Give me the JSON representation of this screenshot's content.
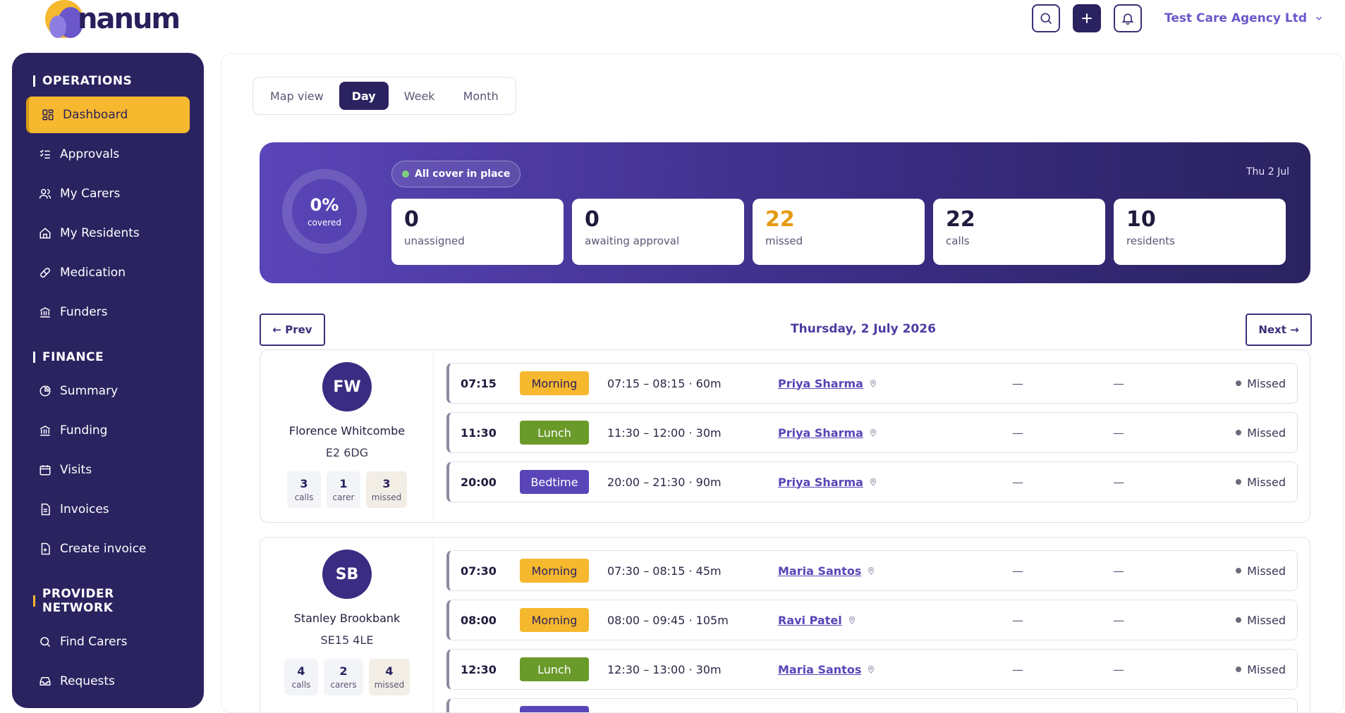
{
  "brand": {
    "name": "nanum"
  },
  "header": {
    "agency": "Test Care Agency Ltd"
  },
  "sidebar": {
    "sections": [
      {
        "title": "OPERATIONS",
        "items": [
          "Dashboard",
          "Approvals",
          "My Carers",
          "My Residents",
          "Medication",
          "Funders"
        ]
      },
      {
        "title": "FINANCE",
        "items": [
          "Summary",
          "Funding",
          "Visits",
          "Invoices",
          "Create invoice"
        ]
      },
      {
        "title": "PROVIDER NETWORK",
        "items": [
          "Find Carers",
          "Requests"
        ]
      }
    ]
  },
  "view_tabs": [
    "Map view",
    "Day",
    "Week",
    "Month"
  ],
  "summary": {
    "covered_pct": "0%",
    "covered_label": "covered",
    "pill": "All cover in place",
    "date": "Thu 2 Jul",
    "stats": [
      {
        "value": "0",
        "label": "unassigned"
      },
      {
        "value": "0",
        "label": "awaiting approval"
      },
      {
        "value": "22",
        "label": "missed"
      },
      {
        "value": "22",
        "label": "calls"
      },
      {
        "value": "10",
        "label": "residents"
      }
    ]
  },
  "nav": {
    "prev": "← Prev",
    "next": "Next →",
    "date": "Thursday, 2 July 2026"
  },
  "residents": [
    {
      "initials": "FW",
      "name": "Florence Whitcombe",
      "postcode": "E2 6DG",
      "chips": [
        {
          "n": "3",
          "t": "calls"
        },
        {
          "n": "1",
          "t": "carer"
        },
        {
          "n": "3",
          "t": "missed"
        }
      ],
      "visits": [
        {
          "time": "07:15",
          "tag": "Morning",
          "range": "07:15 – 08:15 · 60m",
          "carer": "Priya Sharma",
          "d1": "—",
          "d2": "—",
          "status": "Missed"
        },
        {
          "time": "11:30",
          "tag": "Lunch",
          "range": "11:30 – 12:00 · 30m",
          "carer": "Priya Sharma",
          "d1": "—",
          "d2": "—",
          "status": "Missed"
        },
        {
          "time": "20:00",
          "tag": "Bedtime",
          "range": "20:00 – 21:30 · 90m",
          "carer": "Priya Sharma",
          "d1": "—",
          "d2": "—",
          "status": "Missed"
        }
      ]
    },
    {
      "initials": "SB",
      "name": "Stanley Brookbank",
      "postcode": "SE15 4LE",
      "chips": [
        {
          "n": "4",
          "t": "calls"
        },
        {
          "n": "2",
          "t": "carers"
        },
        {
          "n": "4",
          "t": "missed"
        }
      ],
      "visits": [
        {
          "time": "07:30",
          "tag": "Morning",
          "range": "07:30 – 08:15 · 45m",
          "carer": "Maria Santos",
          "d1": "—",
          "d2": "—",
          "status": "Missed"
        },
        {
          "time": "08:00",
          "tag": "Morning",
          "range": "08:00 – 09:45 · 105m",
          "carer": "Ravi Patel",
          "d1": "—",
          "d2": "—",
          "status": "Missed"
        },
        {
          "time": "12:30",
          "tag": "Lunch",
          "range": "12:30 – 13:00 · 30m",
          "carer": "Maria Santos",
          "d1": "—",
          "d2": "—",
          "status": "Missed"
        }
      ]
    }
  ]
}
